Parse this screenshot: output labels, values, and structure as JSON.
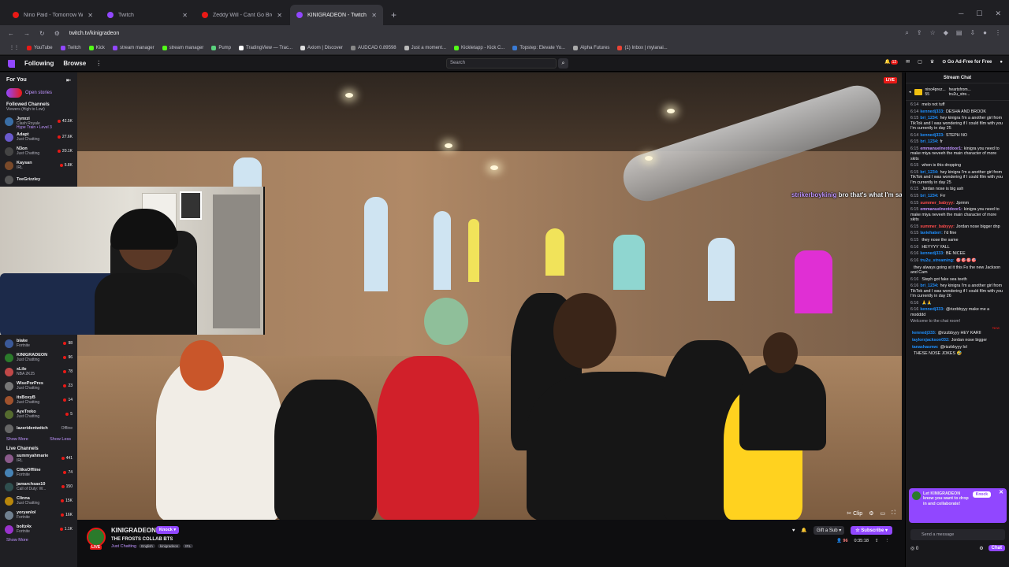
{
  "browser": {
    "tabs": [
      {
        "title": "Nino Paid - Tomorrow Will Be",
        "icon": "youtube-icon",
        "active": false
      },
      {
        "title": "Twitch",
        "icon": "twitch-icon",
        "active": false
      },
      {
        "title": "Zeddy Will - Cant Go Broke (R",
        "icon": "youtube-icon",
        "active": false
      },
      {
        "title": "KINIGRADEON - Twitch",
        "icon": "twitch-icon",
        "active": true
      }
    ],
    "url": "twitch.tv/kinigradeon",
    "bookmarks": [
      "YouTube",
      "Twitch",
      "Kick",
      "stream manager",
      "stream manager",
      "Pump",
      "TradingView — Trac...",
      "Axiom | Discover",
      "AUDCAD 0.89598",
      "Just a moment...",
      "Kickletapp - Kick C...",
      "Topstep: Elevate Yo...",
      "Alpha Futures",
      "(1) Inbox | mylanai..."
    ]
  },
  "topnav": {
    "following": "Following",
    "browse": "Browse",
    "search_placeholder": "Search",
    "notif_count": "12",
    "ad_free": "Go Ad-Free for Free"
  },
  "sidebar": {
    "for_you": "For You",
    "open_stories": "Open stories",
    "followed_title": "Followed Channels",
    "followed_sub": "Viewers (High to Low)",
    "top_channels": [
      {
        "name": "Jynxzi",
        "game": "Clash Royale",
        "viewers": "42.5K",
        "extra": "Hype Train • Level 3"
      },
      {
        "name": "Adapt",
        "game": "Just Chatting",
        "viewers": "27.6K"
      },
      {
        "name": "N3on",
        "game": "Just Chatting",
        "viewers": "20.1K"
      },
      {
        "name": "Kaysan",
        "game": "IRL",
        "viewers": "5.8K"
      },
      {
        "name": "TeeGrizzley",
        "game": "",
        "viewers": ""
      }
    ],
    "lower_channels": [
      {
        "name": "blake",
        "game": "Fortnite",
        "viewers": "98"
      },
      {
        "name": "KINIGRADEON",
        "game": "Just Chatting",
        "viewers": "96"
      },
      {
        "name": "xLile",
        "game": "NBA 2K25",
        "viewers": "78"
      },
      {
        "name": "WisePorPres",
        "game": "Just Chatting",
        "viewers": "23"
      },
      {
        "name": "itsBoxyB",
        "game": "Just Chatting",
        "viewers": "14"
      },
      {
        "name": "AyeTreko",
        "game": "Just Chatting",
        "viewers": "5"
      },
      {
        "name": "lazeridentwitch",
        "game": "",
        "viewers": "Offline"
      }
    ],
    "show_more": "Show More",
    "show_less": "Show Less",
    "live_title": "Live Channels",
    "live_channels": [
      {
        "name": "summyahmarie",
        "game": "IRL",
        "viewers": "441"
      },
      {
        "name": "CliksOffline",
        "game": "Fortnite",
        "viewers": "74"
      },
      {
        "name": "jamarchsae10",
        "game": "Call of Duty: W...",
        "viewers": "150"
      },
      {
        "name": "Clinna",
        "game": "Just Chatting",
        "viewers": "15K"
      },
      {
        "name": "yoryanlol",
        "game": "Fortnite",
        "viewers": "16K"
      },
      {
        "name": "boltz4x",
        "game": "Fortnite",
        "viewers": "1.1K"
      }
    ],
    "show_more_live": "Show More"
  },
  "video": {
    "live": "LIVE",
    "overlay_user": "strikerboykinig",
    "overlay_text": "bro that's what I'm saying",
    "controls": [
      "clip-icon",
      "gear-icon",
      "theatre-icon",
      "fullscreen-icon"
    ],
    "clip_label": "Clip"
  },
  "stream": {
    "name": "KINIGRADEON",
    "knock": "Knock",
    "live": "LIVE",
    "title": "THE FROSTS COLLAB BTS",
    "category": "Just Chatting",
    "tags": [
      "English",
      "kinigradeon",
      "IRL"
    ],
    "gift": "Gift a Sub",
    "subscribe": "Subscribe",
    "viewers": "96",
    "uptime": "0:35:18"
  },
  "chat": {
    "header": "Stream Chat",
    "top_gifters": [
      "nino4prez...",
      "heartsfrom...",
      "tru2u_stre..."
    ],
    "top_count": "55",
    "messages": [
      {
        "t": "6:14",
        "u": "",
        "c": "#ff8280",
        "m": "melo not tuff"
      },
      {
        "t": "6:14",
        "u": "kennedj333:",
        "c": "#1e90ff",
        "m": "DESHA AND BROOK"
      },
      {
        "t": "6:15",
        "u": "bri_1234:",
        "c": "#1e90ff",
        "m": "hey kinigra I'm a another girl from TikTok and I was wondering if I could film with you I'm currently in day 25"
      },
      {
        "t": "6:14",
        "u": "kennedj333:",
        "c": "#1e90ff",
        "m": "STEPH NO"
      },
      {
        "t": "6:15",
        "u": "bri_1234:",
        "c": "#1e90ff",
        "m": "fr"
      },
      {
        "t": "6:15",
        "u": "emmanuelnextdoor1:",
        "c": "#bf94ff",
        "m": "kinigra you need to make miya neveeh the main character of more skits"
      },
      {
        "t": "6:15",
        "u": "",
        "c": "#ff8280",
        "m": "when is this dropping"
      },
      {
        "t": "6:15",
        "u": "bri_1234:",
        "c": "#1e90ff",
        "m": "hey kinigra I'm a another girl from TikTok and I was wondering if I could film with you I'm currently in day 25"
      },
      {
        "t": "6:15",
        "u": "",
        "c": "#ff8280",
        "m": "Jordan nose is big ash"
      },
      {
        "t": "6:15",
        "u": "bri_1234:",
        "c": "#1e90ff",
        "m": "Frr"
      },
      {
        "t": "6:15",
        "u": "summer_babyyy:",
        "c": "#ff4c4c",
        "m": "Jprmm"
      },
      {
        "t": "6:15",
        "u": "emmanuelnextdoor1:",
        "c": "#bf94ff",
        "m": "kinigra you need to make miya neveeh the main character of more skits"
      },
      {
        "t": "6:15",
        "u": "summer_babyyy:",
        "c": "#ff4c4c",
        "m": "Jordan nose bigger dnp"
      },
      {
        "t": "6:15",
        "u": "laviehaterr:",
        "c": "#1e90ff",
        "m": "I'd fine"
      },
      {
        "t": "6:15",
        "u": "",
        "c": "#ff8280",
        "m": "they nose the same"
      },
      {
        "t": "6:16",
        "u": "",
        "c": "#ff8280",
        "m": "HEYYYY YALL"
      },
      {
        "t": "6:16",
        "u": "kennedj333:",
        "c": "#1e90ff",
        "m": "BE NICEE"
      },
      {
        "t": "6:16",
        "u": "tru2u_streaming:",
        "c": "#1e90ff",
        "m": "🎯🎯🎯🎯"
      },
      {
        "t": "",
        "u": "",
        "c": "#efeff1",
        "m": "they always going at it this Fs the new Jackson and Cam"
      },
      {
        "t": "6:16",
        "u": "",
        "c": "#ff8280",
        "m": "Steph got fake sea teeth"
      },
      {
        "t": "6:16",
        "u": "bri_1234:",
        "c": "#1e90ff",
        "m": "hey kinigra I'm a another girl from TikTok and I was wondering if I could film with you I'm currently in day 26"
      },
      {
        "t": "6:16",
        "u": "",
        "c": "#ff8280",
        "m": "🙏🙏"
      },
      {
        "t": "6:16",
        "u": "kennedj333:",
        "c": "#1e90ff",
        "m": "@rizzbbyyy make me a modddd"
      }
    ],
    "welcome": "Welcome to the chat room!",
    "new_label": "New",
    "messages_after": [
      {
        "t": "",
        "u": "kennedj333:",
        "c": "#1e90ff",
        "m": "@rizzbbyyy HEY KARII"
      },
      {
        "t": "",
        "u": "taylorxjackson032:",
        "c": "#1e90ff",
        "m": "Jordan nose bigger"
      },
      {
        "t": "",
        "u": "tanashasmw:",
        "c": "#1e90ff",
        "m": "@rizzbbyyy lol"
      },
      {
        "t": "",
        "u": "",
        "c": "#ff8280",
        "m": "THESE NOSE JOKES 🤣"
      }
    ],
    "collab_text": "Let KINIGRADEON know you want to drop in and collaborate!",
    "collab_knock": "Knock",
    "input_placeholder": "Send a message",
    "points": "0",
    "chat_button": "Chat"
  },
  "colors": {
    "accent": "#9147ff",
    "live": "#e91916",
    "bg": "#0e0e10"
  }
}
